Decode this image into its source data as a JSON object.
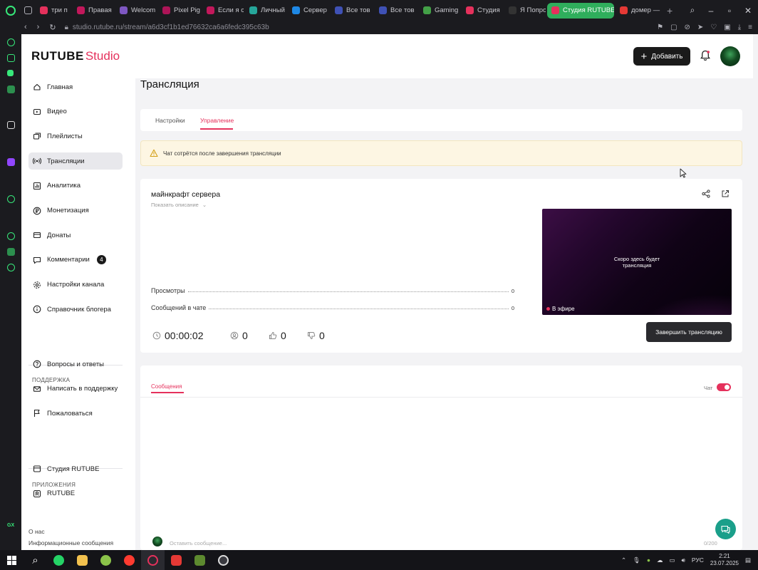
{
  "browser": {
    "tabs": [
      {
        "label": "три п",
        "color": "#e5315c"
      },
      {
        "label": "Правая",
        "color": "#c2185b"
      },
      {
        "label": "Welcom",
        "color": "#7e57c2"
      },
      {
        "label": "Pixel Pig",
        "color": "#ad1457"
      },
      {
        "label": "Если я с",
        "color": "#c2185b"
      },
      {
        "label": "Личный",
        "color": "#26a69a"
      },
      {
        "label": "Сервер",
        "color": "#1e88e5"
      },
      {
        "label": "Все тов",
        "color": "#3f51b5"
      },
      {
        "label": "Все тов",
        "color": "#3f51b5"
      },
      {
        "label": "Gaming",
        "color": "#43a047"
      },
      {
        "label": "Студия",
        "color": "#e5315c"
      },
      {
        "label": "Я Попро",
        "color": "#333333"
      },
      {
        "label": "Студия RUTUBE",
        "color": "#e5315c",
        "active": true
      },
      {
        "label": "домер —",
        "color": "#e53935"
      }
    ],
    "url": "studio.rutube.ru/stream/a6d3cf1b1ed76632ca6a6fedc395c63b"
  },
  "header": {
    "brand": "RUTUBE",
    "brand_suffix": "Studio",
    "add_label": "Добавить"
  },
  "nav": {
    "items": [
      {
        "label": "Главная",
        "icon": "home-icon"
      },
      {
        "label": "Видео",
        "icon": "video-icon"
      },
      {
        "label": "Плейлисты",
        "icon": "playlist-icon"
      },
      {
        "label": "Трансляции",
        "icon": "broadcast-icon",
        "active": true
      },
      {
        "label": "Аналитика",
        "icon": "analytics-icon"
      },
      {
        "label": "Монетизация",
        "icon": "ruble-icon"
      },
      {
        "label": "Донаты",
        "icon": "donate-icon"
      },
      {
        "label": "Комментарии",
        "icon": "comments-icon",
        "badge": "4"
      },
      {
        "label": "Настройки канала",
        "icon": "gear-icon"
      },
      {
        "label": "Справочник блогера",
        "icon": "info-icon"
      }
    ],
    "support_title": "ПОДДЕРЖКА",
    "support": [
      {
        "label": "Вопросы и ответы",
        "icon": "help-icon"
      },
      {
        "label": "Написать в поддержку",
        "icon": "mail-icon"
      },
      {
        "label": "Пожаловаться",
        "icon": "flag-icon"
      }
    ],
    "apps_title": "ПРИЛОЖЕНИЯ",
    "apps": [
      {
        "label": "Студия RUTUBE",
        "icon": "studio-app-icon"
      },
      {
        "label": "RUTUBE",
        "icon": "rutube-app-icon"
      }
    ],
    "footer": [
      "О нас",
      "Информационные сообщения"
    ]
  },
  "page": {
    "title": "Трансляция",
    "tabs": [
      "Настройки",
      "Управление"
    ],
    "active_tab": 1,
    "warning": "Чат сотрётся после завершения трансляции"
  },
  "stream": {
    "title": "майнкрафт сервера",
    "show_description": "Показать описание",
    "stats": [
      {
        "label": "Просмотры",
        "value": "0"
      },
      {
        "label": "Сообщений в чате",
        "value": "0"
      }
    ],
    "preview_text": "Скоро здесь будет трансляция",
    "live_label": "В эфире",
    "timer": "00:00:02",
    "viewers": "0",
    "likes": "0",
    "dislikes": "0",
    "end_label": "Завершить трансляцию"
  },
  "chat": {
    "tab_label": "Сообщения",
    "toggle_label": "Чат",
    "toggle_on": true,
    "input_placeholder": "Оставить сообщение...",
    "counter": "0/200"
  },
  "taskbar": {
    "lang": "РУС",
    "time": "2:21",
    "date": "23.07.2025"
  },
  "colors": {
    "accent": "#e5315c",
    "dark_button": "#1a1a1a",
    "warning_bg": "#fdf6e3",
    "fab": "#1a9f8a"
  }
}
